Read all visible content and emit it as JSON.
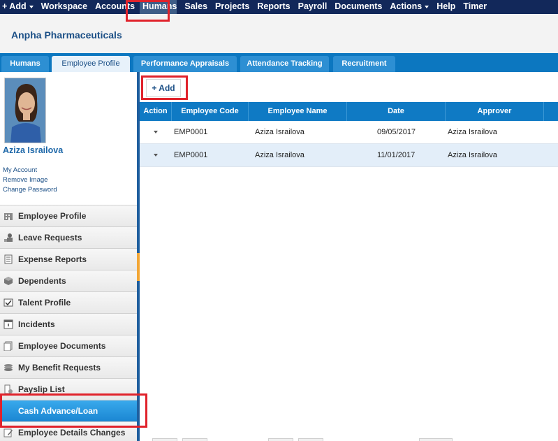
{
  "nav": {
    "items": [
      {
        "label": "+ Add",
        "caret": true
      },
      {
        "label": "Workspace"
      },
      {
        "label": "Accounts"
      },
      {
        "label": "Humans"
      },
      {
        "label": "Sales"
      },
      {
        "label": "Projects"
      },
      {
        "label": "Reports"
      },
      {
        "label": "Payroll"
      },
      {
        "label": "Documents"
      },
      {
        "label": "Actions",
        "caret": true
      },
      {
        "label": "Help"
      },
      {
        "label": "Timer"
      }
    ],
    "active": "Humans"
  },
  "header": {
    "company": "Anpha Pharmaceuticals"
  },
  "tabs": [
    {
      "label": "Humans"
    },
    {
      "label": "Employee Profile",
      "active": true
    },
    {
      "label": "Performance Appraisals"
    },
    {
      "label": "Attendance Tracking"
    },
    {
      "label": "Recruitment"
    }
  ],
  "sidebar": {
    "user_name": "Aziza Israilova",
    "links": [
      "My Account",
      "Remove Image",
      "Change Password"
    ],
    "menu": [
      {
        "label": "Employee Profile",
        "icon": "building-icon"
      },
      {
        "label": "Leave Requests",
        "icon": "person-icon"
      },
      {
        "label": "Expense Reports",
        "icon": "document-icon"
      },
      {
        "label": "Dependents",
        "icon": "cube-icon"
      },
      {
        "label": "Talent Profile",
        "icon": "certificate-icon"
      },
      {
        "label": "Incidents",
        "icon": "alert-icon"
      },
      {
        "label": "Employee Documents",
        "icon": "documents-icon"
      },
      {
        "label": "My Benefit Requests",
        "icon": "stack-icon"
      },
      {
        "label": "Payslip List",
        "icon": "payslip-icon"
      },
      {
        "label": "Cash Advance/Loan",
        "icon": "",
        "active": true
      },
      {
        "label": "Employee Details Changes",
        "icon": "edit-icon"
      }
    ]
  },
  "toolbar": {
    "add_label": "+ Add"
  },
  "grid": {
    "columns": [
      "Action",
      "Employee Code",
      "Employee Name",
      "Date",
      "Approver"
    ],
    "rows": [
      {
        "code": "EMP0001",
        "name": "Aziza Israilova",
        "date": "09/05/2017",
        "approver": "Aziza Israilova"
      },
      {
        "code": "EMP0001",
        "name": "Aziza Israilova",
        "date": "11/01/2017",
        "approver": "Aziza Israilova"
      }
    ]
  },
  "colors": {
    "nav_bg": "#12285a",
    "tab_bar": "#0c77c0",
    "grid_header": "#0f7ac4",
    "active_menu": "#1b86d2",
    "highlight": "#e0222b"
  }
}
